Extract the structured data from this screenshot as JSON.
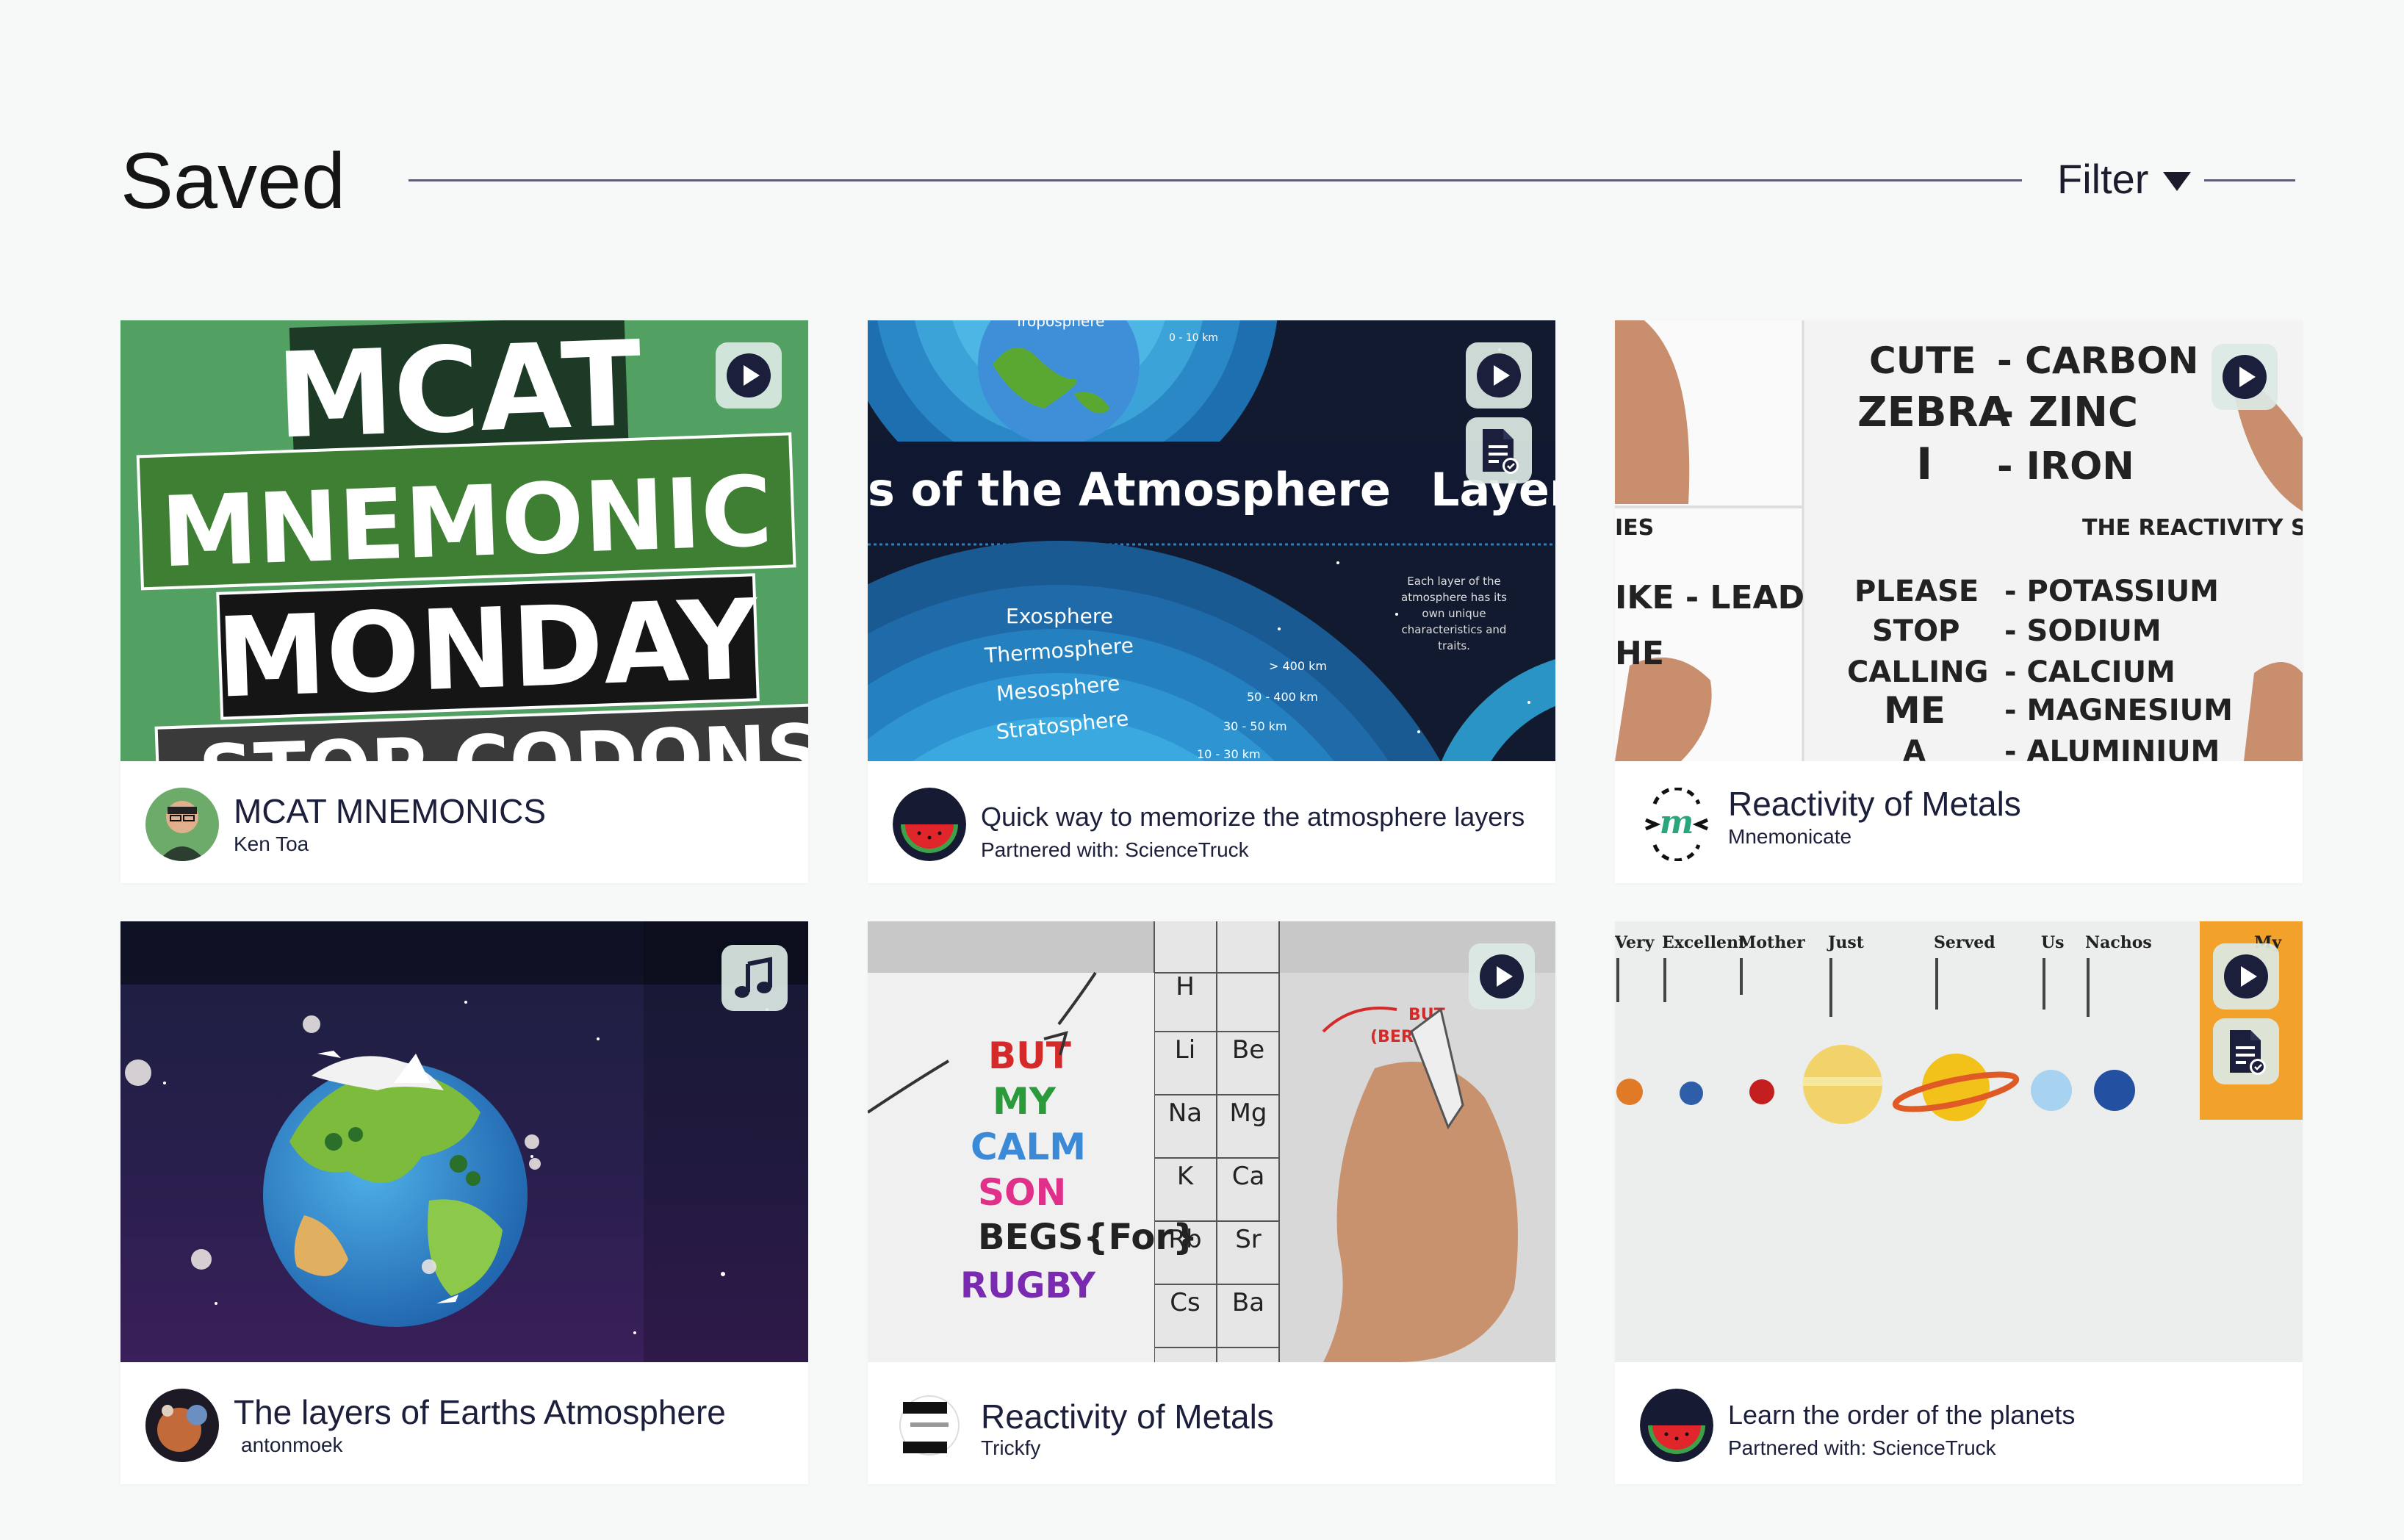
{
  "page": {
    "title": "Saved",
    "filter_label": "Filter"
  },
  "cards": [
    {
      "title": "MCAT MNEMONICS",
      "subtitle": "Ken Toa",
      "media": "video",
      "thumb_lines": [
        "MCAT",
        "MNEMONIC",
        "MONDAY",
        "STOP CODONS"
      ]
    },
    {
      "title": "Quick way to memorize the atmosphere layers",
      "subtitle": "Partnered with: ScienceTruck",
      "media": "video+worksheet",
      "thumb_text": {
        "heading": "s of the Atmosphere",
        "heading_cut": "Layer",
        "top": "Troposphere",
        "range0": "0 - 10 km",
        "layers": [
          "Exosphere",
          "Thermosphere",
          "Mesosphere",
          "Stratosphere"
        ],
        "ranges": [
          "> 400 km",
          "50 - 400 km",
          "30 - 50 km",
          "10 - 30 km"
        ],
        "note": [
          "Each layer of the",
          "atmosphere has its",
          "own unique",
          "characteristics and",
          "traits."
        ]
      }
    },
    {
      "title": "Reactivity of Metals",
      "subtitle": "Mnemonicate",
      "media": "video",
      "thumb_text": {
        "pairs_top": [
          [
            "CUTE",
            "- CARBON"
          ],
          [
            "ZEBRA",
            "- ZINC"
          ],
          [
            "I",
            "- IRON"
          ]
        ],
        "series_label": "THE REACTIVITY SER",
        "left_bits": [
          "IES",
          "IKE - LEAD",
          "HE"
        ],
        "pairs_bottom": [
          [
            "PLEASE",
            "- POTASSIUM"
          ],
          [
            "STOP",
            "- SODIUM"
          ],
          [
            "CALLING",
            "- CALCIUM"
          ],
          [
            "ME",
            "- MAGNESIUM"
          ],
          [
            "A",
            "- ALUMINIUM"
          ]
        ]
      }
    },
    {
      "title": "The layers of Earths Atmosphere",
      "subtitle": "antonmoek",
      "media": "audio"
    },
    {
      "title": "Reactivity of Metals",
      "subtitle": "Trickfy",
      "media": "video",
      "thumb_text": {
        "words": [
          "BUT",
          "MY",
          "CALM",
          "SON",
          "BEGS{For}",
          "RUGBY"
        ],
        "symbols": [
          [
            "H",
            ""
          ],
          [
            "Li",
            "Be"
          ],
          [
            "Na",
            "Mg"
          ],
          [
            "K",
            "Ca"
          ],
          [
            "Rb",
            "Sr"
          ],
          [
            "Cs",
            "Ba"
          ]
        ],
        "note": [
          "BUT",
          "(BERYL"
        ]
      }
    },
    {
      "title": "Learn the order of the planets",
      "subtitle": "Partnered with: ScienceTruck",
      "media": "video+worksheet",
      "thumb_text": {
        "words": [
          "Very",
          "Excellent",
          "Mother",
          "Just",
          "Served",
          "Us",
          "Nachos",
          "My"
        ]
      }
    }
  ],
  "colors": {
    "accent": "#1b1f3b",
    "page_bg": "#f7f9f9",
    "icon_bg": "#dce9e4"
  },
  "icons": {
    "play": "play-icon",
    "worksheet": "worksheet-icon",
    "audio": "music-note-icon"
  }
}
